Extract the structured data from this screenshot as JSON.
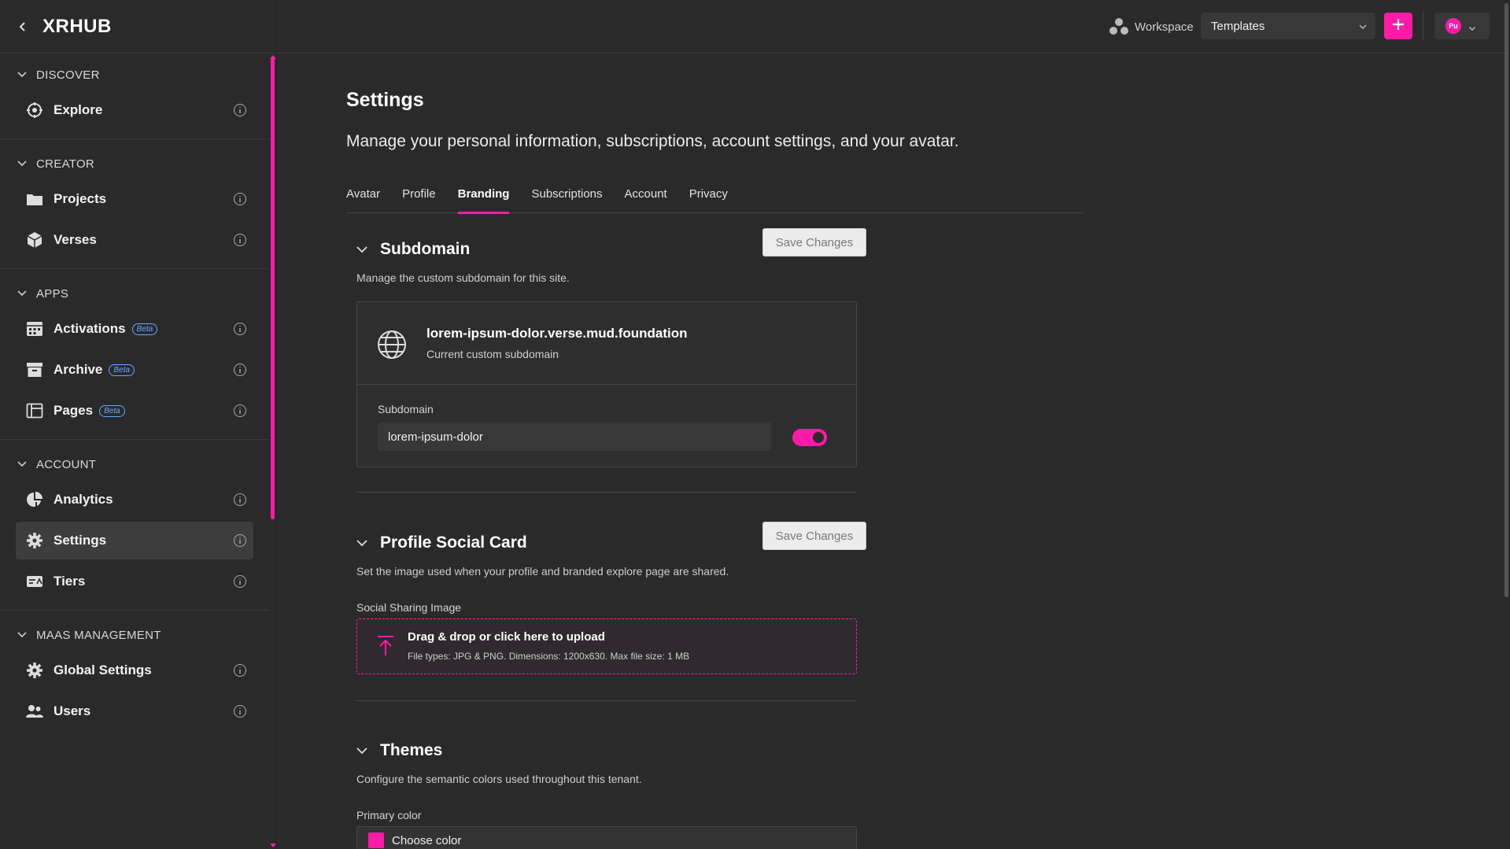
{
  "brand": {
    "title": "XRHUB"
  },
  "sidebar": {
    "sections": [
      {
        "label": "DISCOVER",
        "items": [
          {
            "label": "Explore",
            "icon": "explore-icon"
          }
        ]
      },
      {
        "label": "CREATOR",
        "items": [
          {
            "label": "Projects",
            "icon": "folder-icon"
          },
          {
            "label": "Verses",
            "icon": "cube-icon"
          }
        ]
      },
      {
        "label": "APPS",
        "items": [
          {
            "label": "Activations",
            "badge": "Beta",
            "icon": "grid-icon"
          },
          {
            "label": "Archive",
            "badge": "Beta",
            "icon": "archive-icon"
          },
          {
            "label": "Pages",
            "badge": "Beta",
            "icon": "pages-icon"
          }
        ]
      },
      {
        "label": "ACCOUNT",
        "items": [
          {
            "label": "Analytics",
            "icon": "analytics-icon"
          },
          {
            "label": "Settings",
            "icon": "gear-icon",
            "active": true
          },
          {
            "label": "Tiers",
            "icon": "tiers-icon"
          }
        ]
      },
      {
        "label": "MAAS MANAGEMENT",
        "items": [
          {
            "label": "Global Settings",
            "icon": "gear-icon"
          },
          {
            "label": "Users",
            "icon": "users-icon"
          }
        ]
      }
    ]
  },
  "topbar": {
    "workspace_label": "Workspace",
    "workspace_value": "Templates",
    "user_initials": "Pu"
  },
  "main": {
    "title": "Settings",
    "subtitle": "Manage your personal information, subscriptions, account settings, and your avatar.",
    "tabs": [
      {
        "label": "Avatar"
      },
      {
        "label": "Profile"
      },
      {
        "label": "Branding",
        "active": true
      },
      {
        "label": "Subscriptions"
      },
      {
        "label": "Account"
      },
      {
        "label": "Privacy"
      }
    ],
    "subdomain": {
      "heading": "Subdomain",
      "save_label": "Save Changes",
      "description": "Manage the custom subdomain for this site.",
      "current_domain": "lorem-ipsum-dolor.verse.mud.foundation",
      "current_caption": "Current custom subdomain",
      "field_label": "Subdomain",
      "field_value": "lorem-ipsum-dolor",
      "toggle_on": true
    },
    "social_card": {
      "heading": "Profile Social Card",
      "save_label": "Save Changes",
      "description": "Set the image used when your profile and branded explore page are shared.",
      "field_label": "Social Sharing Image",
      "upload_title": "Drag & drop or click here to upload",
      "upload_hint": "File types: JPG & PNG. Dimensions: 1200x630. Max file size: 1 MB"
    },
    "themes": {
      "heading": "Themes",
      "description": "Configure the semantic colors used throughout this tenant.",
      "primary_label": "Primary color",
      "primary_button": "Choose color",
      "primary_color": "#ff1aa8"
    }
  },
  "colors": {
    "accent": "#ff1aa8",
    "beta": "#6aa8ff",
    "background": "#2a2a2a"
  }
}
